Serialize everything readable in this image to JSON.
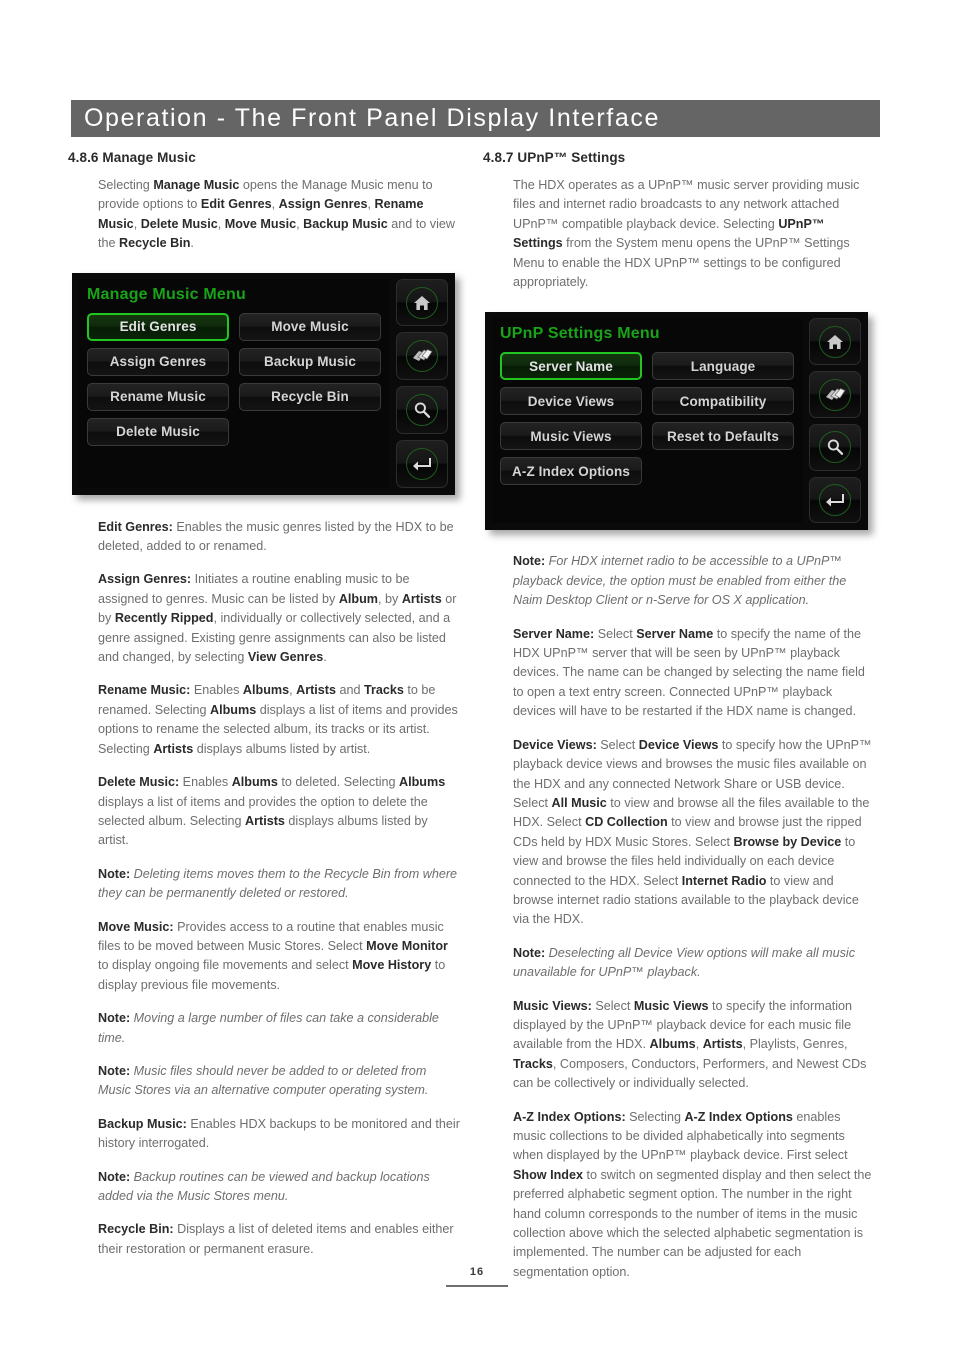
{
  "header": {
    "title": "Operation - The Front Panel Display Interface"
  },
  "left_column": {
    "section_heading": "4.8.6 Manage Music",
    "intro_prefix": "Selecting ",
    "intro_b1": "Manage Music",
    "intro_mid1": " opens the Manage Music menu to provide options to ",
    "intro_b2": "Edit Genres",
    "intro_sep1": ", ",
    "intro_b3": "Assign Genres",
    "intro_sep2": ", ",
    "intro_b4": "Rename Music",
    "intro_sep3": ", ",
    "intro_b5": "Delete Music",
    "intro_sep4": ", ",
    "intro_b6": "Move Music",
    "intro_sep5": ", ",
    "intro_b7": "Backup Music",
    "intro_mid2": " and to view the ",
    "intro_b8": "Recycle Bin",
    "intro_end": ".",
    "paragraphs": [
      {
        "lead": "Edit Genres:",
        "text": " Enables the music genres listed by the HDX to be deleted, added to or renamed."
      },
      {
        "lead": "Assign Genres:",
        "text": " Initiates a routine enabling music to be assigned to genres. Music can be listed by Album, by Artists or by Recently Ripped, individually or collectively selected, and a genre assigned. Existing genre assignments can also be listed and changed, by selecting View Genres."
      },
      {
        "lead": "Rename Music:",
        "text": " Enables Albums, Artists and Tracks to be renamed. Selecting Albums displays a list of items and provides options to rename the selected album, its tracks or its artist. Selecting Artists displays albums listed by artist."
      },
      {
        "lead": "Delete Music:",
        "text": " Enables Albums to deleted. Selecting Albums displays a list of items and provides the option to delete the selected album. Selecting Artists displays albums listed by artist."
      },
      {
        "lead": "Note:",
        "text": " Deleting items moves them to the Recycle Bin from where they can be permanently deleted or restored."
      },
      {
        "lead": "Move Music:",
        "text": " Provides access to a routine that enables music files to be moved between Music Stores. Select Move Monitor to display ongoing file movements and select Move History to display previous file movements."
      },
      {
        "lead": "Note:",
        "text": " Moving a large number of files can take a considerable time."
      },
      {
        "lead": "Note:",
        "text": " Music files should never be added to or deleted from Music Stores via an alternative computer operating system."
      },
      {
        "lead": "Backup Music:",
        "text": " Enables HDX backups to be monitored and their history interrogated."
      },
      {
        "lead": "Note:",
        "text": " Backup routines can be viewed and backup locations added via the Music Stores menu."
      },
      {
        "lead": "Recycle Bin:",
        "text": " Displays a list of deleted items and enables either their restoration or permanent erasure."
      }
    ]
  },
  "right_column": {
    "section_heading": "4.8.7 UPnP™ Settings",
    "intro_a": "The HDX operates as a UPnP™ music server providing music files and internet radio broadcasts to any network attached UPnP™ compatible playback device. Selecting ",
    "intro_b": "UPnP™ Settings",
    "intro_c": " from the System menu opens the UPnP™ Settings Menu to enable the HDX UPnP™ settings to be configured appropriately.",
    "paragraphs": [
      {
        "lead": "Note:",
        "text": " For HDX internet radio to be accessible to a UPnP™ playback device, the option must be enabled from either the Naim Desktop Client or n-Serve for OS X application."
      },
      {
        "lead": "Server Name:",
        "text": " Select Server Name to specify the name of the HDX UPnP™ server that will be seen by UPnP™ playback devices. The name can be changed by selecting the name field to open a text entry screen. Connected UPnP™ playback devices will have to be restarted if the HDX name is changed."
      },
      {
        "lead": "Device Views:",
        "text": " Select Device Views to specify how the UPnP™ playback device views and browses the music files available on the HDX and any connected Network Share or USB device. Select All Music to view and browse all the files available to the HDX. Select CD Collection to view and browse just the ripped CDs held by HDX Music Stores. Select Browse by Device to view and browse the files held individually on each device connected to the HDX. Select Internet Radio to view and browse internet radio stations available to the playback device via the HDX."
      },
      {
        "lead": "Note:",
        "text": " Deselecting all Device View options will make all music unavailable for UPnP™ playback."
      },
      {
        "lead": "Music Views:",
        "text": " Select Music Views to specify the information displayed by the UPnP™ playback device for each music file available from the HDX. Albums, Artists, Playlists, Genres, Tracks, Composers, Conductors, Performers, and Newest CDs can be collectively or individually selected."
      },
      {
        "lead": "A-Z Index Options:",
        "text": " Selecting A-Z Index Options enables music collections to be divided alphabetically into segments when displayed by the UPnP™ playback device. First select Show Index to switch on segmented display and then select the preferred alphabetic segment option. The number in the right hand column corresponds to the number of items in the music collection above which the selected alphabetic segmentation is implemented. The number can be adjusted for each segmentation option."
      }
    ]
  },
  "manage_music_screen": {
    "title": "Manage Music Menu",
    "buttons": [
      {
        "label": "Edit Genres",
        "selected": true
      },
      {
        "label": "Move Music",
        "selected": false
      },
      {
        "label": "Assign Genres",
        "selected": false
      },
      {
        "label": "Backup Music",
        "selected": false
      },
      {
        "label": "Rename Music",
        "selected": false
      },
      {
        "label": "Recycle Bin",
        "selected": false
      },
      {
        "label": "Delete Music",
        "selected": false
      }
    ],
    "rail_icons": [
      "home-icon",
      "layers-icon",
      "search-icon",
      "enter-icon"
    ],
    "accent_green": "#19a319",
    "select_border": "#22c522"
  },
  "upnp_settings_screen": {
    "title": "UPnP Settings Menu",
    "buttons": [
      {
        "label": "Server Name",
        "selected": true
      },
      {
        "label": "Language",
        "selected": false
      },
      {
        "label": "Device Views",
        "selected": false
      },
      {
        "label": "Compatibility",
        "selected": false
      },
      {
        "label": "Music Views",
        "selected": false
      },
      {
        "label": "Reset to Defaults",
        "selected": false
      },
      {
        "label": "A-Z Index Options",
        "selected": false
      }
    ],
    "rail_icons": [
      "home-icon",
      "layers-icon",
      "search-icon",
      "enter-icon"
    ],
    "accent_green": "#19a319",
    "select_border": "#22c522"
  },
  "footer": {
    "page_number": "16"
  }
}
